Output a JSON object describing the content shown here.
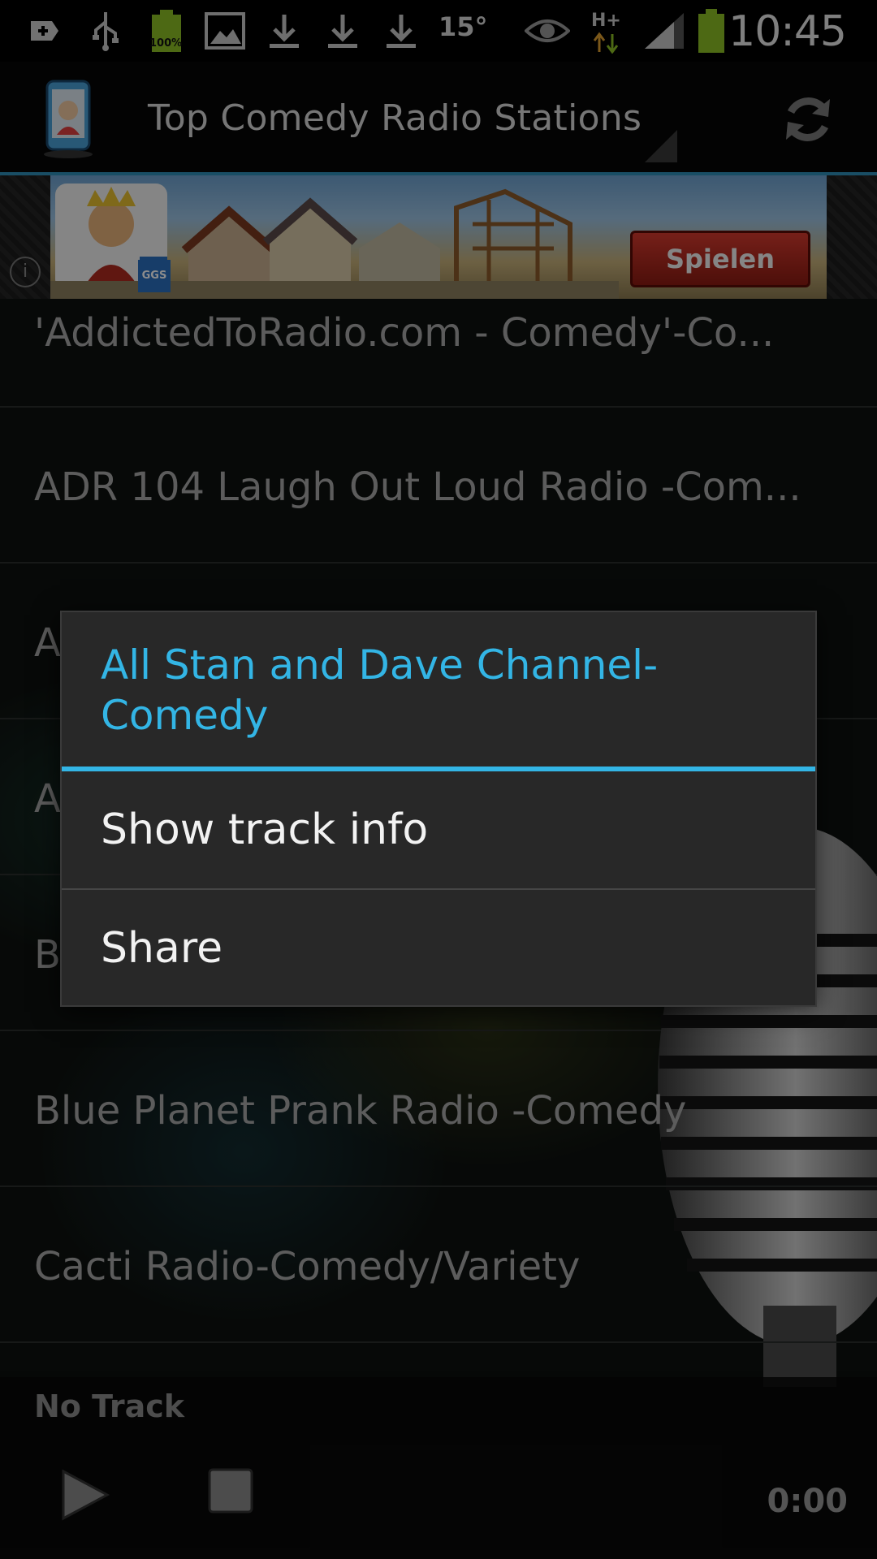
{
  "status_bar": {
    "time": "10:45",
    "temperature": "15°",
    "battery_level_label": "100%",
    "icons": [
      "add-icon",
      "usb-icon",
      "battery-full-icon",
      "image-icon",
      "download-icon",
      "download-icon",
      "download-icon",
      "eye-icon",
      "network-hplus-icon",
      "signal-icon",
      "battery-icon"
    ]
  },
  "action_bar": {
    "title": "Top Comedy Radio Stations",
    "refresh_icon": "refresh-icon"
  },
  "ad_banner": {
    "button_label": "Spielen",
    "brand": "GGS",
    "info_icon": "i"
  },
  "stations": [
    "'AddictedToRadio.com - Comedy'-Co...",
    "ADR 104 Laugh Out Loud Radio -Com...",
    "A",
    "A",
    "B",
    "Blue Planet Prank Radio  -Comedy",
    "Cacti Radio-Comedy/Variety"
  ],
  "player": {
    "now_playing": "No Track",
    "elapsed": "0:00"
  },
  "context_menu": {
    "title": "All Stan and Dave Channel-Comedy",
    "items": [
      "Show track info",
      "Share"
    ]
  },
  "colors": {
    "accent": "#33b5e5",
    "dialog_bg": "#282828",
    "action_bar_divider": "#2f8fb8"
  }
}
